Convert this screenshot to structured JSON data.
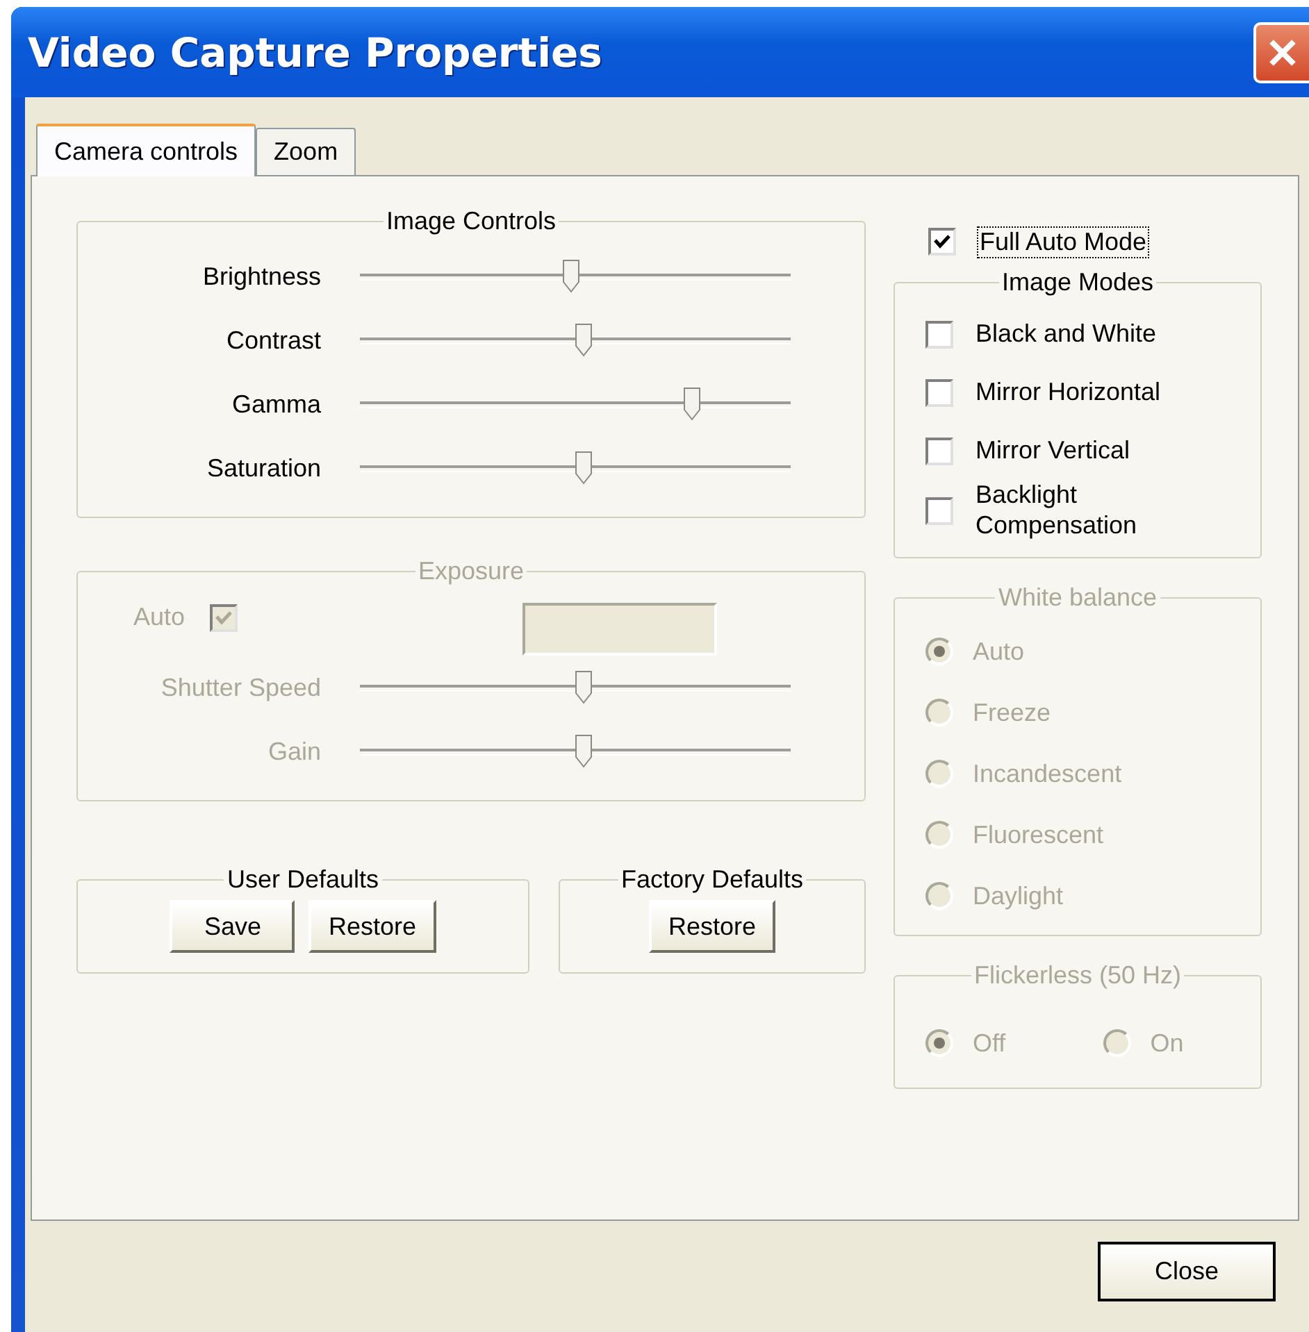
{
  "window": {
    "title": "Video Capture Properties"
  },
  "tabs": [
    {
      "label": "Camera controls",
      "selected": true
    },
    {
      "label": "Zoom",
      "selected": false
    }
  ],
  "image_controls": {
    "title": "Image Controls",
    "disabled": false,
    "sliders": [
      {
        "label": "Brightness",
        "level": 0.49
      },
      {
        "label": "Contrast",
        "level": 0.52
      },
      {
        "label": "Gamma",
        "level": 0.77
      },
      {
        "label": "Saturation",
        "level": 0.52
      }
    ]
  },
  "exposure": {
    "title": "Exposure",
    "disabled": true,
    "auto": {
      "label": "Auto",
      "checked": true
    },
    "sliders": [
      {
        "label": "Shutter Speed",
        "level": 0.52
      },
      {
        "label": "Gain",
        "level": 0.52
      }
    ]
  },
  "user_defaults": {
    "title": "User Defaults",
    "buttons": [
      "Save",
      "Restore"
    ]
  },
  "factory_defaults": {
    "title": "Factory Defaults",
    "buttons": [
      "Restore"
    ]
  },
  "full_auto_mode": {
    "label": "Full Auto Mode",
    "checked": true,
    "focused": true
  },
  "image_modes": {
    "title": "Image Modes",
    "disabled": false,
    "options": [
      {
        "label": "Black and White",
        "checked": false
      },
      {
        "label": "Mirror Horizontal",
        "checked": false
      },
      {
        "label": "Mirror Vertical",
        "checked": false
      },
      {
        "label": "Backlight Compensation",
        "checked": false
      }
    ]
  },
  "white_balance": {
    "title": "White balance",
    "disabled": true,
    "options": [
      {
        "label": "Auto",
        "selected": true
      },
      {
        "label": "Freeze",
        "selected": false
      },
      {
        "label": "Incandescent",
        "selected": false
      },
      {
        "label": "Fluorescent",
        "selected": false
      },
      {
        "label": "Daylight",
        "selected": false
      }
    ]
  },
  "flickerless": {
    "title": "Flickerless (50 Hz)",
    "disabled": true,
    "options": [
      {
        "label": "Off",
        "selected": true
      },
      {
        "label": "On",
        "selected": false
      }
    ]
  },
  "buttons": [
    "Close"
  ]
}
